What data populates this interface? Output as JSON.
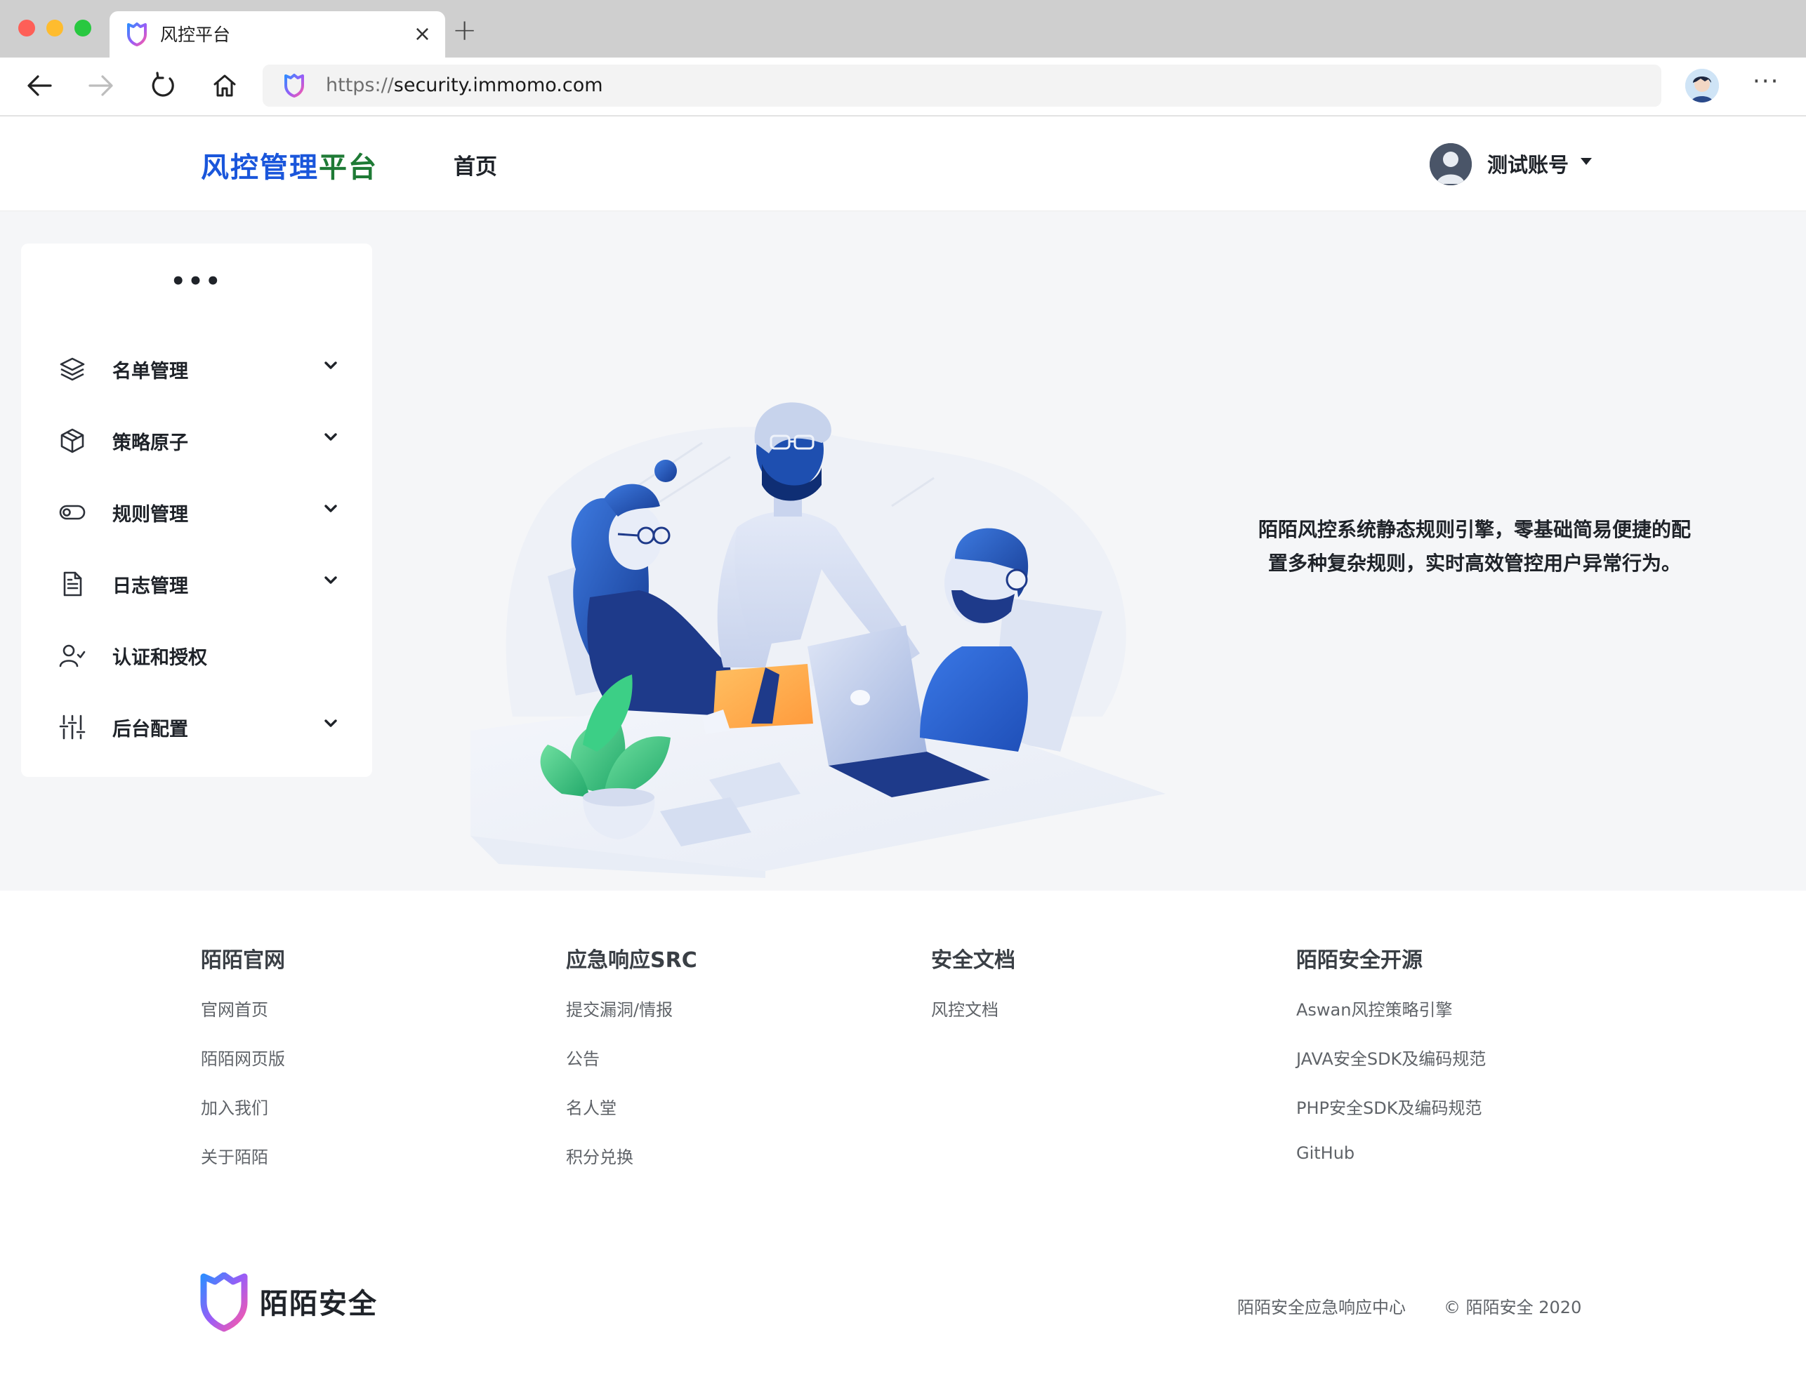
{
  "browser": {
    "tab_title": "风控平台",
    "tab_close": "×",
    "new_tab": "+",
    "url_protocol": "https://",
    "url_host": "security.immomo.com",
    "more_menu": "···"
  },
  "header": {
    "brand_part1": "风控管理",
    "brand_part2": "平台",
    "nav_home": "首页",
    "user_name": "测试账号",
    "colors": {
      "brand_blue": "#1a56db",
      "brand_green": "#1e7a35"
    }
  },
  "sidebar": {
    "collapse_dots": "•••",
    "items": [
      {
        "label": "名单管理",
        "icon": "layers-icon",
        "has_submenu": true
      },
      {
        "label": "策略原子",
        "icon": "cube-icon",
        "has_submenu": true
      },
      {
        "label": "规则管理",
        "icon": "toggle-icon",
        "has_submenu": true
      },
      {
        "label": "日志管理",
        "icon": "document-icon",
        "has_submenu": true
      },
      {
        "label": "认证和授权",
        "icon": "user-check-icon",
        "has_submenu": false
      },
      {
        "label": "后台配置",
        "icon": "sliders-icon",
        "has_submenu": true
      }
    ]
  },
  "main": {
    "tagline_line1": "陌陌风控系统静态规则引擎，零基础简易便捷的配",
    "tagline_line2": "置多种复杂规则，实时高效管控用户异常行为。"
  },
  "footer": {
    "columns": [
      {
        "title": "陌陌官网",
        "links": [
          "官网首页",
          "陌陌网页版",
          "加入我们",
          "关于陌陌"
        ]
      },
      {
        "title": "应急响应SRC",
        "links": [
          "提交漏洞/情报",
          "公告",
          "名人堂",
          "积分兑换"
        ]
      },
      {
        "title": "安全文档",
        "links": [
          "风控文档"
        ]
      },
      {
        "title": "陌陌安全开源",
        "links": [
          "Aswan风控策略引擎",
          "JAVA安全SDK及编码规范",
          "PHP安全SDK及编码规范",
          "GitHub"
        ]
      }
    ],
    "logo_text": "陌陌安全",
    "bottom_link": "陌陌安全应急响应中心",
    "copyright": "© 陌陌安全 2020"
  }
}
